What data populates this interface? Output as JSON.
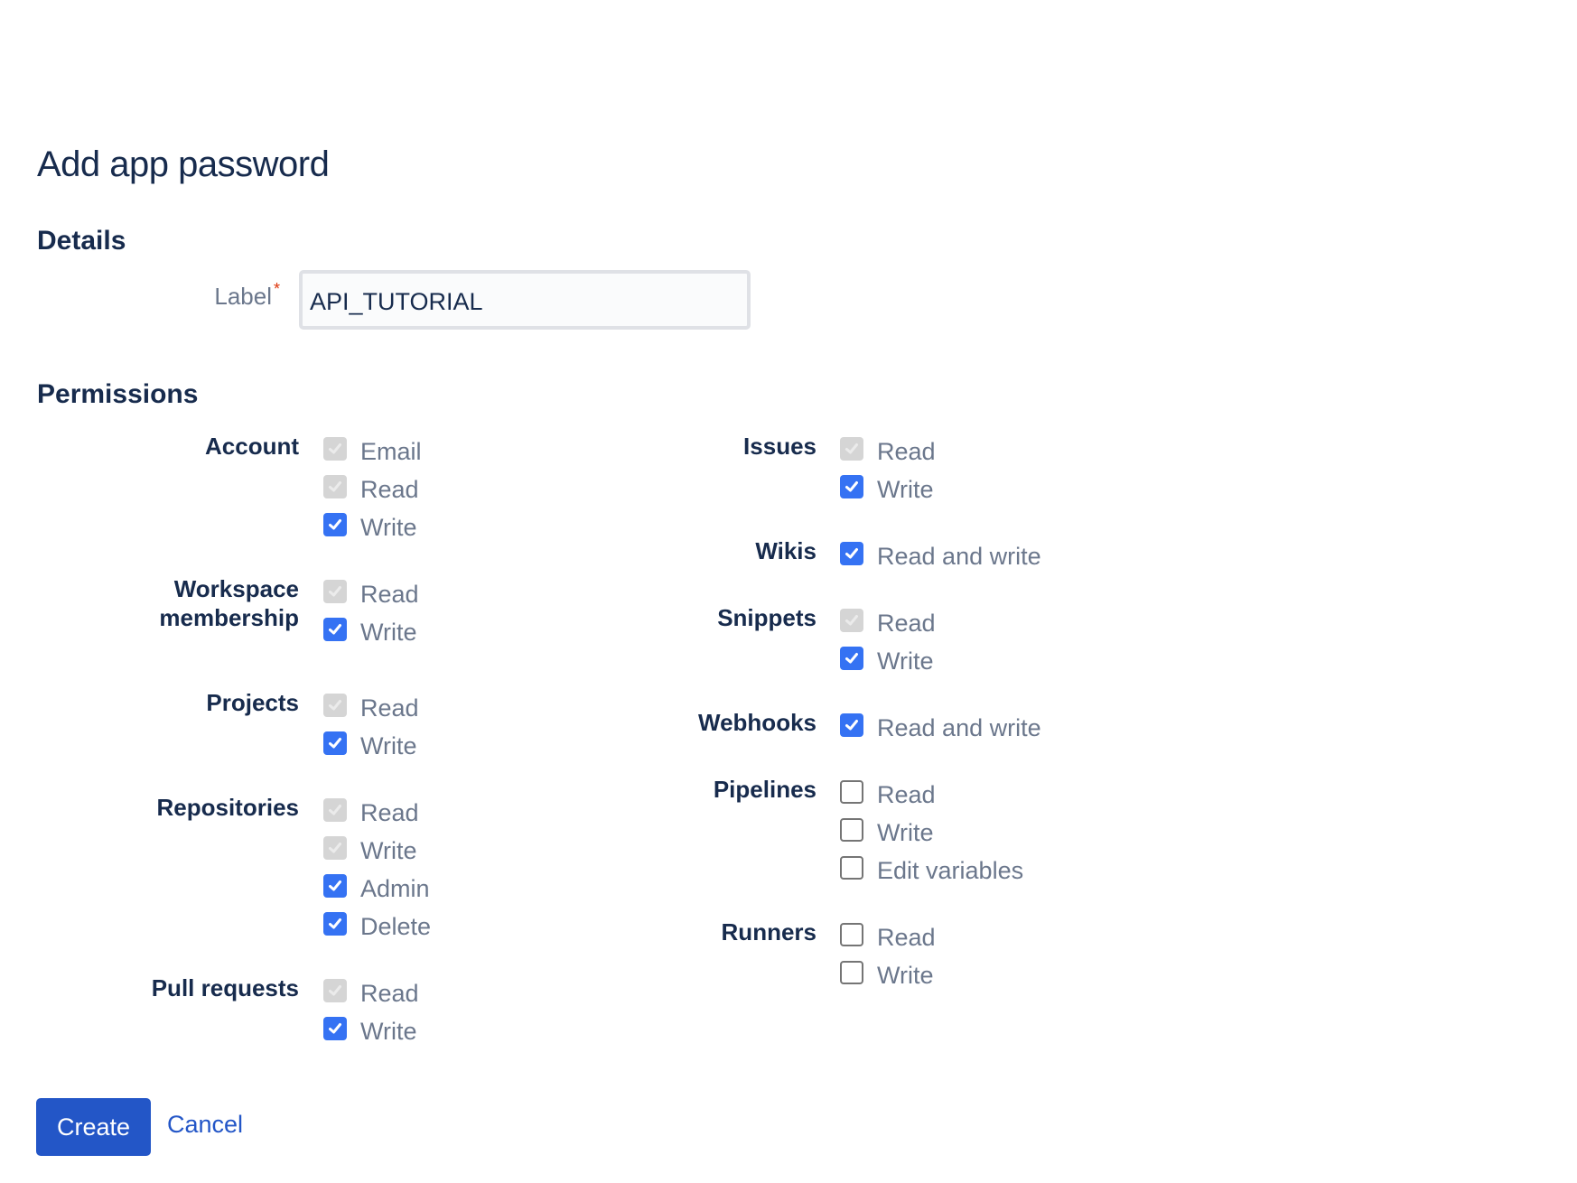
{
  "page": {
    "title": "Add app password",
    "details_heading": "Details",
    "permissions_heading": "Permissions"
  },
  "details": {
    "label_field": {
      "label": "Label",
      "required_marker": "*",
      "value": "API_TUTORIAL",
      "placeholder": ""
    }
  },
  "permissions": {
    "left_column": [
      {
        "group": "Account",
        "options": [
          {
            "label": "Email",
            "state": "disabled"
          },
          {
            "label": "Read",
            "state": "disabled"
          },
          {
            "label": "Write",
            "state": "checked"
          }
        ]
      },
      {
        "group": "Workspace membership",
        "group_lines": [
          "Workspace",
          "membership"
        ],
        "options": [
          {
            "label": "Read",
            "state": "disabled"
          },
          {
            "label": "Write",
            "state": "checked"
          }
        ]
      },
      {
        "group": "Projects",
        "options": [
          {
            "label": "Read",
            "state": "disabled"
          },
          {
            "label": "Write",
            "state": "checked"
          }
        ]
      },
      {
        "group": "Repositories",
        "options": [
          {
            "label": "Read",
            "state": "disabled"
          },
          {
            "label": "Write",
            "state": "disabled"
          },
          {
            "label": "Admin",
            "state": "checked"
          },
          {
            "label": "Delete",
            "state": "checked"
          }
        ]
      },
      {
        "group": "Pull requests",
        "options": [
          {
            "label": "Read",
            "state": "disabled"
          },
          {
            "label": "Write",
            "state": "checked"
          }
        ]
      }
    ],
    "right_column": [
      {
        "group": "Issues",
        "options": [
          {
            "label": "Read",
            "state": "disabled"
          },
          {
            "label": "Write",
            "state": "checked"
          }
        ]
      },
      {
        "group": "Wikis",
        "options": [
          {
            "label": "Read and write",
            "state": "checked"
          }
        ]
      },
      {
        "group": "Snippets",
        "options": [
          {
            "label": "Read",
            "state": "disabled"
          },
          {
            "label": "Write",
            "state": "checked"
          }
        ]
      },
      {
        "group": "Webhooks",
        "options": [
          {
            "label": "Read and write",
            "state": "checked"
          }
        ]
      },
      {
        "group": "Pipelines",
        "options": [
          {
            "label": "Read",
            "state": "unchecked"
          },
          {
            "label": "Write",
            "state": "unchecked"
          },
          {
            "label": "Edit variables",
            "state": "unchecked"
          }
        ]
      },
      {
        "group": "Runners",
        "options": [
          {
            "label": "Read",
            "state": "unchecked"
          },
          {
            "label": "Write",
            "state": "unchecked"
          }
        ]
      }
    ]
  },
  "actions": {
    "create_label": "Create",
    "cancel_label": "Cancel"
  },
  "colors": {
    "primary": "#2356c7",
    "checkbox_checked": "#3572f3",
    "checkbox_disabled": "#d5d5d5",
    "heading_text": "#172b4d",
    "muted_text": "#6b778c",
    "required": "#de350b"
  }
}
